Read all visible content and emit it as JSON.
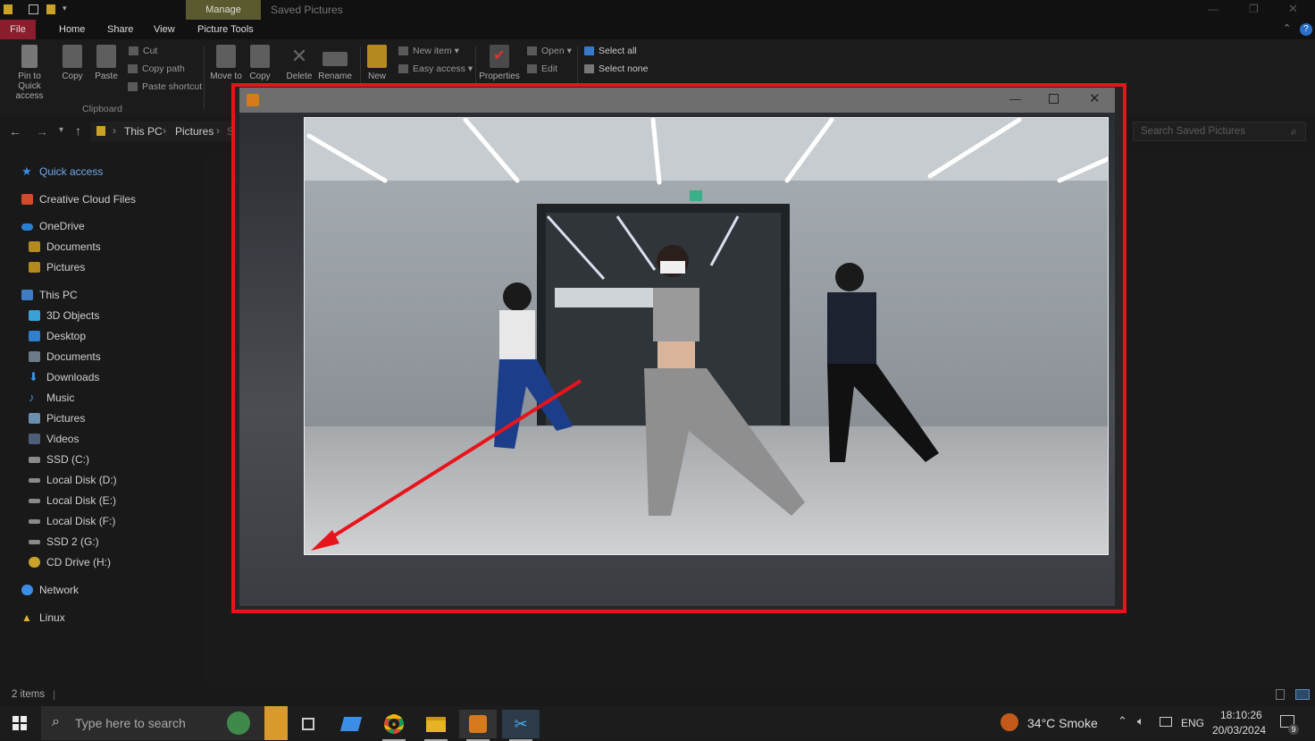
{
  "titlebar": {
    "manage_tab": "Manage",
    "window_title": "Saved Pictures"
  },
  "ribbon_tabs": [
    "File",
    "Home",
    "Share",
    "View",
    "Picture Tools"
  ],
  "ribbon": {
    "pin_label": "Pin to Quick access",
    "copy_label": "Copy",
    "paste_label": "Paste",
    "cut_label": "Cut",
    "copy_path_label": "Copy path",
    "paste_shortcut_label": "Paste shortcut",
    "clipboard_group": "Clipboard",
    "move_label": "Move to",
    "copy_to_label": "Copy",
    "delete_label": "Delete",
    "rename_label": "Rename",
    "new_label": "New",
    "new_item_label": "New item",
    "easy_access_label": "Easy access",
    "properties_label": "Properties",
    "open_label": "Open",
    "edit_label": "Edit",
    "select_all_label": "Select all",
    "select_none_label": "Select none"
  },
  "address": {
    "crumbs": [
      "This PC",
      "Pictures",
      "Sa"
    ],
    "search_placeholder": "Search Saved Pictures"
  },
  "sidebar": {
    "quick_access": "Quick access",
    "creative_cloud": "Creative Cloud Files",
    "onedrive": "OneDrive",
    "onedrive_items": [
      "Documents",
      "Pictures"
    ],
    "this_pc": "This PC",
    "pc_items": [
      "3D Objects",
      "Desktop",
      "Documents",
      "Downloads",
      "Music",
      "Pictures",
      "Videos",
      "SSD (C:)",
      "Local Disk (D:)",
      "Local Disk (E:)",
      "Local Disk (F:)",
      "SSD 2 (G:)",
      "CD Drive (H:)"
    ],
    "network": "Network",
    "linux": "Linux"
  },
  "status": {
    "items": "2 items"
  },
  "taskbar": {
    "search_placeholder": "Type here to search",
    "weather": "34°C  Smoke",
    "lang": "ENG",
    "time": "18:10:26",
    "date": "20/03/2024",
    "notif_count": "9"
  },
  "colors": {
    "highlight": "#e8141b",
    "manage_tab": "#5b5a2e",
    "file_tab": "#8b1d2c"
  }
}
